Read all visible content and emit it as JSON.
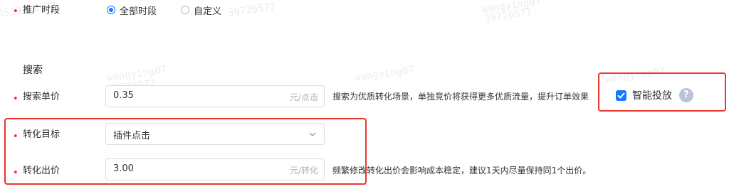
{
  "schedule": {
    "label": "推广时段",
    "options": [
      {
        "label": "全部时段",
        "checked": true
      },
      {
        "label": "自定义",
        "checked": false
      }
    ]
  },
  "search_section": {
    "title": "搜索"
  },
  "search_bid": {
    "label": "搜索单价",
    "value": "0.35",
    "unit": "元/点击",
    "help": "搜索为优质转化场景，单独竞价将获得更多优质流量，提升订单效果",
    "smart_delivery": {
      "label": "智能投放",
      "checked": true,
      "help_icon": "?"
    }
  },
  "conversion_goal": {
    "label": "转化目标",
    "value": "插件点击"
  },
  "conversion_bid": {
    "label": "转化出价",
    "value": "3.00",
    "unit": "元/转化",
    "help": "频繁修改转化出价会影响成本稳定，建议1天内尽量保持同1个出价。"
  },
  "watermark": {
    "name": "wangying07",
    "id": "39726577"
  },
  "colors": {
    "accent": "#1677ff",
    "required": "#f5222d",
    "highlight_border": "#e8372c"
  }
}
